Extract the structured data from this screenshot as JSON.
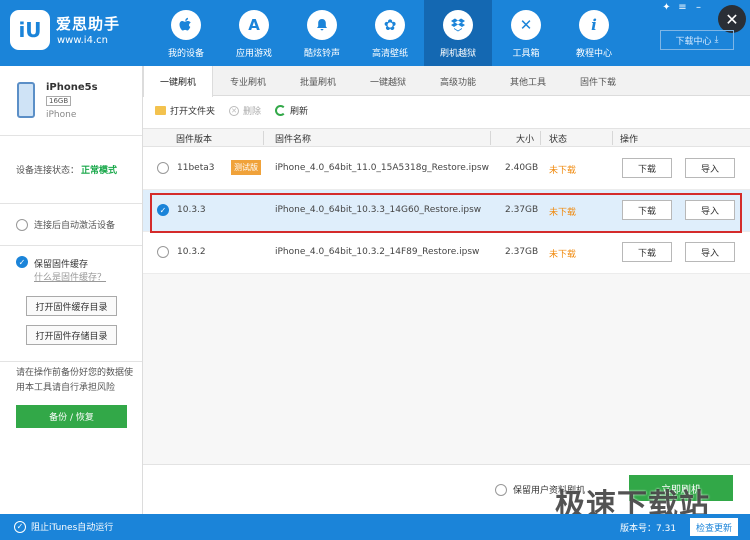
{
  "app": {
    "title": "爱思助手",
    "url": "www.i4.cn",
    "logo_text": "iU",
    "accent": "#1b84d9",
    "green": "#32a848"
  },
  "nav": [
    {
      "label": "我的设备",
      "icon": "apple-icon",
      "glyph": ""
    },
    {
      "label": "应用游戏",
      "icon": "app-store-icon",
      "glyph": "A"
    },
    {
      "label": "酷炫铃声",
      "icon": "bell-icon",
      "glyph": "♪"
    },
    {
      "label": "高清壁纸",
      "icon": "flower-icon",
      "glyph": "✿"
    },
    {
      "label": "刷机越狱",
      "icon": "box-icon",
      "glyph": "❖",
      "active": true
    },
    {
      "label": "工具箱",
      "icon": "tools-icon",
      "glyph": "✕"
    },
    {
      "label": "教程中心",
      "icon": "info-icon",
      "glyph": "i"
    }
  ],
  "window": {
    "download_center": "下载中心",
    "close_glyph": "✕"
  },
  "device": {
    "name": "iPhone5s",
    "capacity": "16GB",
    "model": "iPhone"
  },
  "sidebar": {
    "conn_label": "设备连接状态：",
    "conn_status": "正常模式",
    "auto_activate": "连接后自动激活设备",
    "keep_cache": "保留固件缓存",
    "what_is_cache": "什么是固件缓存？",
    "open_cache_dir": "打开固件缓存目录",
    "open_store_dir": "打开固件存储目录",
    "warning": "请在操作前备份好您的数据使用本工具请自行承担风险",
    "backup": "备份 / 恢复"
  },
  "tabs": [
    "一键刷机",
    "专业刷机",
    "批量刷机",
    "一键越狱",
    "高级功能",
    "其他工具",
    "固件下载"
  ],
  "toolbar": {
    "open_folder": "打开文件夹",
    "delete": "删除",
    "refresh": "刷新"
  },
  "table": {
    "headers": {
      "version": "固件版本",
      "name": "固件名称",
      "size": "大小",
      "status": "状态",
      "action": "操作"
    },
    "rows": [
      {
        "version": "11beta3",
        "tag": "测试版",
        "name": "iPhone_4.0_64bit_11.0_15A5318g_Restore.ipsw",
        "size": "2.40GB",
        "status": "未下载",
        "download": "下载",
        "import": "导入",
        "selected": false
      },
      {
        "version": "10.3.3",
        "name": "iPhone_4.0_64bit_10.3.3_14G60_Restore.ipsw",
        "size": "2.37GB",
        "status": "未下载",
        "download": "下载",
        "import": "导入",
        "selected": true
      },
      {
        "version": "10.3.2",
        "name": "iPhone_4.0_64bit_10.3.2_14F89_Restore.ipsw",
        "size": "2.37GB",
        "status": "未下载",
        "download": "下载",
        "import": "导入",
        "selected": false
      }
    ]
  },
  "bottom": {
    "keep_user_data": "保留用户资料刷机",
    "flash_now": "立即刷机",
    "watermark": "极速下载站"
  },
  "footer": {
    "block_itunes": "阻止iTunes自动运行",
    "version": "版本号：7.31",
    "check_update": "检查更新"
  }
}
